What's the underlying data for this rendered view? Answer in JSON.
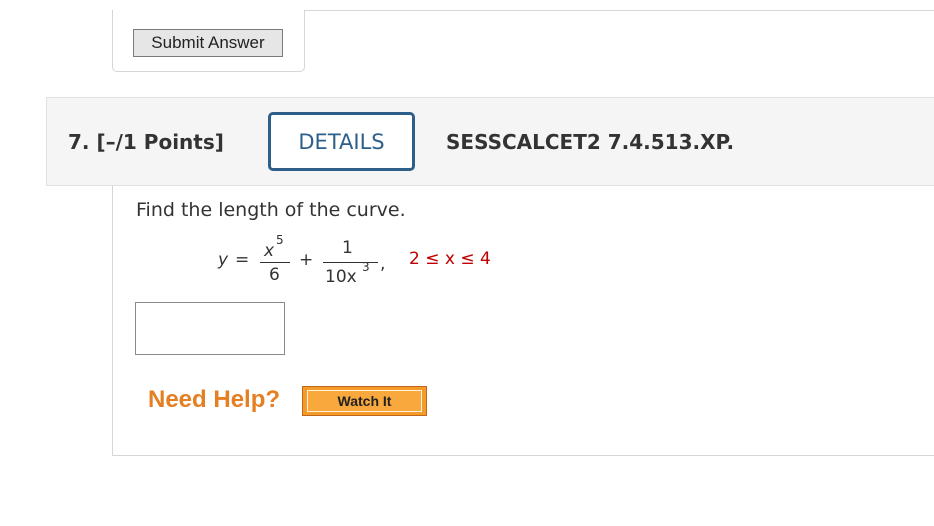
{
  "previous": {
    "submit_label": "Submit Answer"
  },
  "question": {
    "number_label": "7.  [–/1 Points]",
    "details_label": "DETAILS",
    "code": "SESSCALCET2 7.4.513.XP.",
    "prompt": "Find the length of the curve.",
    "formula": {
      "lhs": "y",
      "equals": "=",
      "term1_num_base": "x",
      "term1_num_exp": "5",
      "term1_den": "6",
      "plus": "+",
      "term2_num": "1",
      "term2_den_base": "10x",
      "term2_den_exp": "3",
      "comma": ",",
      "interval": "2 ≤ x ≤ 4"
    },
    "answer_value": "",
    "need_help_label": "Need Help?",
    "watch_label": "Watch It"
  },
  "colors": {
    "accent": "#2e5f8a",
    "help_orange": "#e67e22",
    "interval_red": "#c00000",
    "button_orange": "#f39c2a"
  }
}
